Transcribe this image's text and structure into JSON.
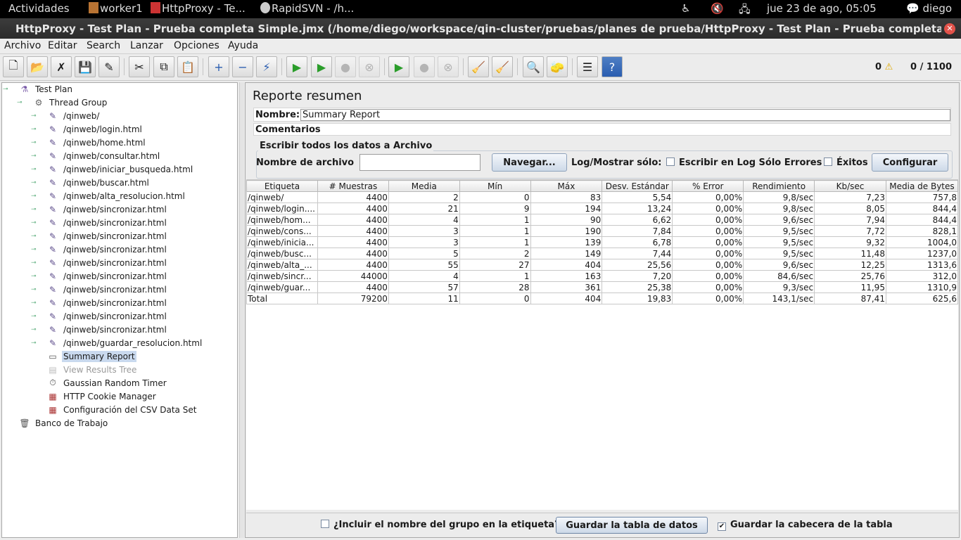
{
  "top_panel": {
    "activities": "Actividades",
    "tasks": [
      "worker1",
      "HttpProxy - Te...",
      "RapidSVN - /h..."
    ],
    "clock": "jue 23 de ago, 05:05",
    "user": "diego"
  },
  "window": {
    "title": "HttpProxy - Test Plan - Prueba completa Simple.jmx (/home/diego/workspace/qin-cluster/pruebas/planes de prueba/HttpProxy - Test Plan - Prueba completa Si"
  },
  "menu": [
    "Archivo",
    "Editar",
    "Search",
    "Lanzar",
    "Opciones",
    "Ayuda"
  ],
  "toolbar": {
    "warnings": "0",
    "threads": "0 / 1100"
  },
  "tree": {
    "test_plan": "Test Plan",
    "thread_group": "Thread Group",
    "samplers": [
      "/qinweb/",
      "/qinweb/login.html",
      "/qinweb/home.html",
      "/qinweb/consultar.html",
      "/qinweb/iniciar_busqueda.html",
      "/qinweb/buscar.html",
      "/qinweb/alta_resolucion.html",
      "/qinweb/sincronizar.html",
      "/qinweb/sincronizar.html",
      "/qinweb/sincronizar.html",
      "/qinweb/sincronizar.html",
      "/qinweb/sincronizar.html",
      "/qinweb/sincronizar.html",
      "/qinweb/sincronizar.html",
      "/qinweb/sincronizar.html",
      "/qinweb/sincronizar.html",
      "/qinweb/sincronizar.html",
      "/qinweb/guardar_resolucion.html"
    ],
    "summary_report": "Summary Report",
    "view_results_tree": "View Results Tree",
    "gaussian_timer": "Gaussian Random Timer",
    "cookie_manager": "HTTP Cookie Manager",
    "csv_data_set": "Configuración del CSV Data Set",
    "workbench": "Banco de Trabajo"
  },
  "report": {
    "title": "Reporte resumen",
    "name_label": "Nombre:",
    "name_value": "Summary Report",
    "comments_label": "Comentarios",
    "file_group_title": "Escribir todos los datos a Archivo",
    "filename_label": "Nombre de archivo",
    "filename_value": "",
    "browse_button": "Navegar...",
    "log_label": "Log/Mostrar sólo:",
    "errors_only_label": "Escribir en Log Sólo Errores",
    "success_label": "Éxitos",
    "configure_button": "Configurar",
    "columns": [
      "Etiqueta",
      "# Muestras",
      "Media",
      "Mín",
      "Máx",
      "Desv. Estándar",
      "% Error",
      "Rendimiento",
      "Kb/sec",
      "Media de Bytes"
    ],
    "rows": [
      [
        "/qinweb/",
        "4400",
        "2",
        "0",
        "83",
        "5,54",
        "0,00%",
        "9,8/sec",
        "7,23",
        "757,8"
      ],
      [
        "/qinweb/login....",
        "4400",
        "21",
        "9",
        "194",
        "13,24",
        "0,00%",
        "9,8/sec",
        "8,05",
        "844,4"
      ],
      [
        "/qinweb/hom...",
        "4400",
        "4",
        "1",
        "90",
        "6,62",
        "0,00%",
        "9,6/sec",
        "7,94",
        "844,4"
      ],
      [
        "/qinweb/cons...",
        "4400",
        "3",
        "1",
        "190",
        "7,84",
        "0,00%",
        "9,5/sec",
        "7,72",
        "828,1"
      ],
      [
        "/qinweb/inicia...",
        "4400",
        "3",
        "1",
        "139",
        "6,78",
        "0,00%",
        "9,5/sec",
        "9,32",
        "1004,0"
      ],
      [
        "/qinweb/busc...",
        "4400",
        "5",
        "2",
        "149",
        "7,44",
        "0,00%",
        "9,5/sec",
        "11,48",
        "1237,0"
      ],
      [
        "/qinweb/alta_...",
        "4400",
        "55",
        "27",
        "404",
        "25,56",
        "0,00%",
        "9,6/sec",
        "12,25",
        "1313,6"
      ],
      [
        "/qinweb/sincr...",
        "44000",
        "4",
        "1",
        "163",
        "7,20",
        "0,00%",
        "84,6/sec",
        "25,76",
        "312,0"
      ],
      [
        "/qinweb/guar...",
        "4400",
        "57",
        "28",
        "361",
        "25,38",
        "0,00%",
        "9,3/sec",
        "11,95",
        "1310,9"
      ],
      [
        "Total",
        "79200",
        "11",
        "0",
        "404",
        "19,83",
        "0,00%",
        "143,1/sec",
        "87,41",
        "625,6"
      ]
    ],
    "include_group_label": "¿Incluir el nombre del grupo en la etiqueta?",
    "save_table_button": "Guardar la tabla de datos",
    "save_header_label": "Guardar la cabecera de la tabla",
    "save_header_checked": true,
    "include_group_checked": false
  },
  "colors": {
    "selection": "#c9d9ee",
    "button_border": "#8fa3bc",
    "close_button": "#e2524a"
  }
}
